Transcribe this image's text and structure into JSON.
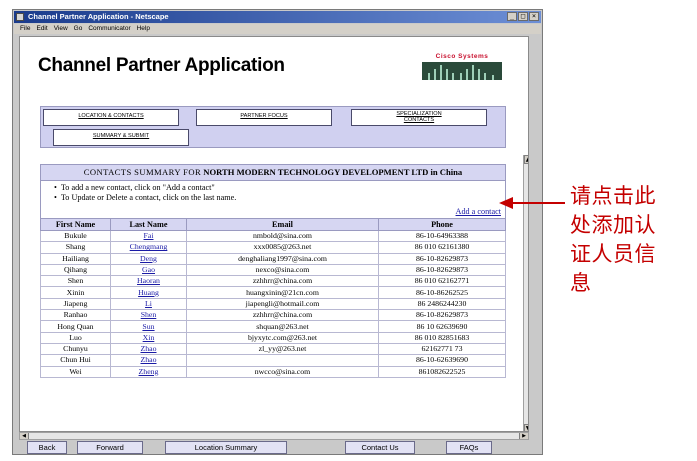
{
  "window": {
    "title": "Channel Partner Application - Netscape",
    "controls": {
      "minimize": "_",
      "maximize": "□",
      "close": "×"
    },
    "menu": [
      "File",
      "Edit",
      "View",
      "Go",
      "Communicator",
      "Help"
    ]
  },
  "page": {
    "title": "Channel Partner Application",
    "logo_text": "Cisco Systems"
  },
  "tabs": {
    "location": "LOCATION & CONTACTS",
    "partner": "PARTNER FOCUS",
    "specialization_line1": "SPECIALIZATION",
    "specialization_line2": "CONTACTS",
    "summary": "SUMMARY & SUBMIT"
  },
  "summary": {
    "header_prefix": "CONTACTS SUMMARY FOR",
    "company": "NORTH MODERN TECHNOLOGY DEVELOPMENT LTD in China",
    "instruction_1": "To add a new contact, click on \"Add a contact\"",
    "instruction_2": "To Update or Delete a contact, click on the last name.",
    "add_contact": "Add a contact"
  },
  "table": {
    "headers": {
      "first": "First Name",
      "last": "Last Name",
      "email": "Email",
      "phone": "Phone"
    },
    "rows": [
      {
        "first": "Bukule",
        "last": "Fai",
        "email": "nmbold@sina.com",
        "phone": "86-10-64963388"
      },
      {
        "first": "Shang",
        "last": "Chengmang",
        "email": "xxx0085@263.net",
        "phone": "86 010 62161380"
      },
      {
        "first": "Hailiang",
        "last": "Deng",
        "email": "denghaliang1997@sina.com",
        "phone": "86-10-82629873"
      },
      {
        "first": "Qihang",
        "last": "Gao",
        "email": "nexco@sina.com",
        "phone": "86-10-82629873"
      },
      {
        "first": "Shen",
        "last": "Haoran",
        "email": "zzhhrr@china.com",
        "phone": "86 010 62162771"
      },
      {
        "first": "Xinin",
        "last": "Huang",
        "email": "huangxinin@21cn.com",
        "phone": "86-10-86262525"
      },
      {
        "first": "Jiapeng",
        "last": "Li",
        "email": "jiapengli@hotmail.com",
        "phone": "86 2486244230"
      },
      {
        "first": "Ranhao",
        "last": "Shen",
        "email": "zzhhrr@china.com",
        "phone": "86-10-82629873"
      },
      {
        "first": "Hong Quan",
        "last": "Sun",
        "email": "shquan@263.net",
        "phone": "86 10 62639690"
      },
      {
        "first": "Luo",
        "last": "Xin",
        "email": "bjyxytc.com@263.net",
        "phone": "86 010 82851683"
      },
      {
        "first": "Chunyu",
        "last": "Zhao",
        "email": "zl_yy@263.net",
        "phone": "62162771 73"
      },
      {
        "first": "Chun Hui",
        "last": "Zhao",
        "email": "",
        "phone": "86-10-62639690"
      },
      {
        "first": "Wei",
        "last": "Zheng",
        "email": "nwcco@sina.com",
        "phone": "861082622525"
      }
    ]
  },
  "nav": {
    "back": "Back",
    "forward": "Forward",
    "location_summary": "Location Summary",
    "contact_us": "Contact Us",
    "faqs": "FAQs"
  },
  "annotation": {
    "line1": "请点击此",
    "line2": "处添加认",
    "line3": "证人员信",
    "line4": "息",
    "color": "#c40000"
  },
  "colors": {
    "titlebar": "#1a3b8c",
    "panel": "#d0d0f0",
    "link": "#1a1aa6",
    "logo": "#c8102e"
  }
}
